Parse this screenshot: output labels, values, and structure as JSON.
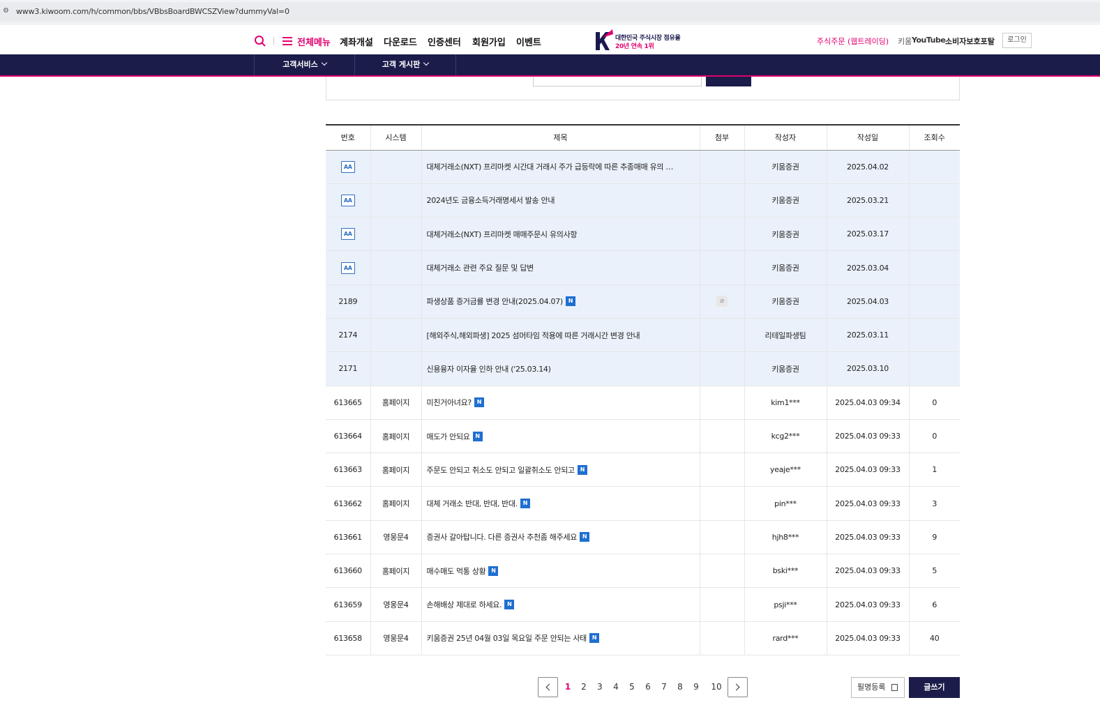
{
  "browser": {
    "url": "www3.kiwoom.com/h/common/bbs/VBbsBoardBWCSZView?dummyVal=0"
  },
  "header": {
    "menu_all": "전체메뉴",
    "gnb": [
      "계좌개설",
      "다운로드",
      "인증센터",
      "회원가입",
      "이벤트"
    ],
    "logo_line1": "대한민국 주식시장 점유율",
    "logo_line2": "20년 연속 1위",
    "util_order": "주식주문 (웹트레이딩)",
    "util_youtube_prefix": "키움",
    "util_youtube": "YouTube",
    "util_consumer": "소비자보호포탈",
    "login": "로그인",
    "brand_color": "#e3006e",
    "navy_color": "#1b1c4a"
  },
  "subnav": {
    "items": [
      "고객서비스",
      "고객 게시판"
    ]
  },
  "table": {
    "headers": [
      "번호",
      "시스템",
      "제목",
      "첨부",
      "작성자",
      "작성일",
      "조회수"
    ],
    "rows": [
      {
        "no": "",
        "aa": "AA",
        "system": "",
        "title": "대체거래소(NXT) 프리마켓 시간대 거래시 주가 급등락에 따른 추종매매 유의 …",
        "new": "",
        "attach": "",
        "author": "키움증권",
        "date": "2025.04.02",
        "views": "",
        "notice": true
      },
      {
        "no": "",
        "aa": "AA",
        "system": "",
        "title": "2024년도 금융소득거래명세서 발송 안내",
        "new": "",
        "attach": "",
        "author": "키움증권",
        "date": "2025.03.21",
        "views": "",
        "notice": true
      },
      {
        "no": "",
        "aa": "AA",
        "system": "",
        "title": "대체거래소(NXT) 프리마켓 매매주문시 유의사항",
        "new": "",
        "attach": "",
        "author": "키움증권",
        "date": "2025.03.17",
        "views": "",
        "notice": true
      },
      {
        "no": "",
        "aa": "AA",
        "system": "",
        "title": "대체거래소 관련 주요 질문 및 답변",
        "new": "",
        "attach": "",
        "author": "키움증권",
        "date": "2025.03.04",
        "views": "",
        "notice": true
      },
      {
        "no": "2189",
        "aa": "",
        "system": "",
        "title": "파생상품 증거금률 변경 안내(2025.04.07)",
        "new": "N",
        "attach": "clip",
        "author": "키움증권",
        "date": "2025.04.03",
        "views": "",
        "notice": true
      },
      {
        "no": "2174",
        "aa": "",
        "system": "",
        "title": "[해외주식,해외파생] 2025 섬머타임 적용에 따른 거래시간 변경 안내",
        "new": "",
        "attach": "",
        "author": "리테일파생팀",
        "date": "2025.03.11",
        "views": "",
        "notice": true
      },
      {
        "no": "2171",
        "aa": "",
        "system": "",
        "title": "신용융자 이자율 인하 안내 ('25.03.14)",
        "new": "",
        "attach": "",
        "author": "키움증권",
        "date": "2025.03.10",
        "views": "",
        "notice": true
      },
      {
        "no": "613665",
        "aa": "",
        "system": "홈페이지",
        "title": "미친거아녀요?",
        "new": "N",
        "attach": "",
        "author": "kim1***",
        "date": "2025.04.03 09:34",
        "views": "0",
        "notice": false
      },
      {
        "no": "613664",
        "aa": "",
        "system": "홈페이지",
        "title": "매도가 안되요",
        "new": "N",
        "attach": "",
        "author": "kcg2***",
        "date": "2025.04.03 09:33",
        "views": "0",
        "notice": false
      },
      {
        "no": "613663",
        "aa": "",
        "system": "홈페이지",
        "title": "주문도 안되고 취소도 안되고 일괄취소도 안되고",
        "new": "N",
        "attach": "",
        "author": "yeaje***",
        "date": "2025.04.03 09:33",
        "views": "1",
        "notice": false
      },
      {
        "no": "613662",
        "aa": "",
        "system": "홈페이지",
        "title": "대체 거래소 반대, 반대, 반대.",
        "new": "N",
        "attach": "",
        "author": "pin***",
        "date": "2025.04.03 09:33",
        "views": "3",
        "notice": false
      },
      {
        "no": "613661",
        "aa": "",
        "system": "영웅문4",
        "title": "증권사 갈아탑니다. 다른 증권사 추천좀 해주세요",
        "new": "N",
        "attach": "",
        "author": "hjh8***",
        "date": "2025.04.03 09:33",
        "views": "9",
        "notice": false
      },
      {
        "no": "613660",
        "aa": "",
        "system": "홈페이지",
        "title": "매수매도 먹통 상황",
        "new": "N",
        "attach": "",
        "author": "bski***",
        "date": "2025.04.03 09:33",
        "views": "5",
        "notice": false
      },
      {
        "no": "613659",
        "aa": "",
        "system": "영웅문4",
        "title": "손해배상 제대로 하세요.",
        "new": "N",
        "attach": "",
        "author": "psji***",
        "date": "2025.04.03 09:33",
        "views": "6",
        "notice": false
      },
      {
        "no": "613658",
        "aa": "",
        "system": "영웅문4",
        "title": "키움증권 25년 04월 03일 목요일 주문 안되는 사태",
        "new": "N",
        "attach": "",
        "author": "rard***",
        "date": "2025.04.03 09:33",
        "views": "40",
        "notice": false
      }
    ]
  },
  "pager": {
    "pages": [
      "1",
      "2",
      "3",
      "4",
      "5",
      "6",
      "7",
      "8",
      "9",
      "10"
    ],
    "active": "1"
  },
  "actions": {
    "pen": "필명등록",
    "write": "글쓰기"
  }
}
